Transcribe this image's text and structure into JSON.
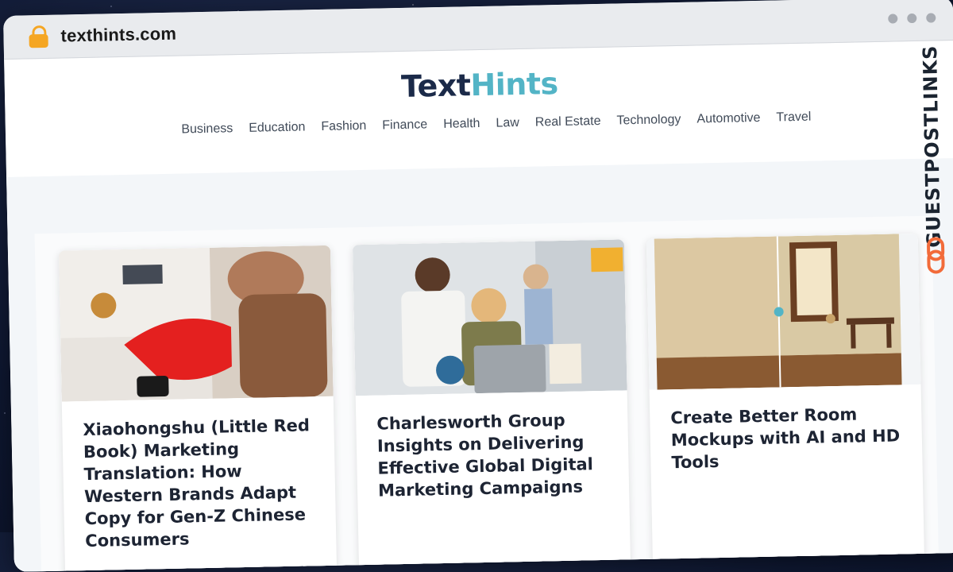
{
  "browser": {
    "url": "texthints.com"
  },
  "site": {
    "logo_text": "Text",
    "logo_hints": "Hints",
    "nav": [
      "Business",
      "Education",
      "Fashion",
      "Finance",
      "Health",
      "Law",
      "Real Estate",
      "Technology",
      "Automotive",
      "Travel"
    ]
  },
  "cards": [
    {
      "title": "Xiaohongshu (Little Red Book) Marketing Translation: How Western Brands Adapt Copy for Gen-Z Chinese Consumers"
    },
    {
      "title": "Charlesworth Group Insights on Delivering Effective Global Digital Marketing Campaigns"
    },
    {
      "title": "Create Better Room Mockups with AI and HD Tools"
    }
  ],
  "side_brand": {
    "label": "GUESTPOSTLINKS"
  },
  "colors": {
    "accent": "#53b4c6",
    "brand_dark": "#1b2a49",
    "lock": "#f5a623",
    "side_icon": "#f26b3a"
  }
}
